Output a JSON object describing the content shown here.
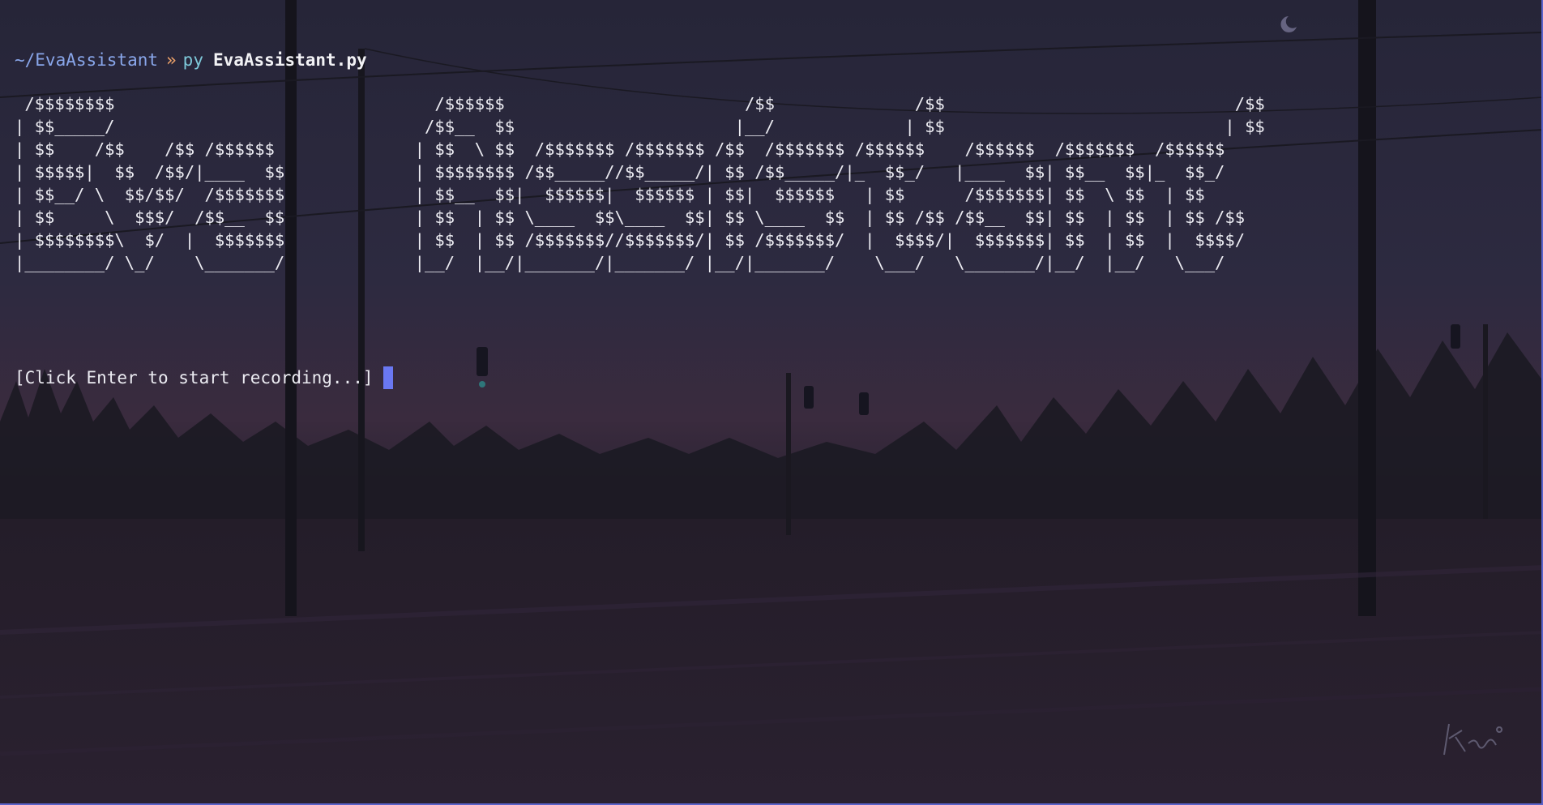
{
  "prompt": {
    "cwd": "~/EvaAssistant",
    "chevron": "»",
    "command": "py",
    "argument": "EvaAssistant.py"
  },
  "banner_lines": [
    " /$$$$$$$$                                /$$$$$$                        /$$              /$$                             /$$",
    "| $$_____/                               /$$__  $$                      |__/             | $$                            | $$",
    "| $$    /$$    /$$ /$$$$$$              | $$  \\ $$  /$$$$$$$ /$$$$$$$ /$$  /$$$$$$$ /$$$$$$    /$$$$$$  /$$$$$$$  /$$$$$$",
    "| $$$$$|  $$  /$$/|____  $$             | $$$$$$$$ /$$_____//$$_____/| $$ /$$_____/|_  $$_/   |____  $$| $$__  $$|_  $$_/",
    "| $$__/ \\  $$/$$/  /$$$$$$$             | $$__  $$|  $$$$$$|  $$$$$$ | $$|  $$$$$$   | $$      /$$$$$$$| $$  \\ $$  | $$",
    "| $$     \\  $$$/  /$$__  $$             | $$  | $$ \\____  $$\\____  $$| $$ \\____  $$  | $$ /$$ /$$__  $$| $$  | $$  | $$ /$$",
    "| $$$$$$$$\\  $/  |  $$$$$$$             | $$  | $$ /$$$$$$$//$$$$$$$/| $$ /$$$$$$$/  |  $$$$/|  $$$$$$$| $$  | $$  |  $$$$/",
    "|________/ \\_/    \\_______/             |__/  |__/|_______/|_______/ |__/|_______/    \\___/   \\_______/|__/  |__/   \\___/"
  ],
  "status_message": "[Click Enter to start recording...]",
  "colors": {
    "accent": "#6a78f2",
    "cwd": "#89a6ea",
    "chevron": "#f0a36a",
    "command": "#7ec8d9",
    "text": "#ececf2"
  }
}
